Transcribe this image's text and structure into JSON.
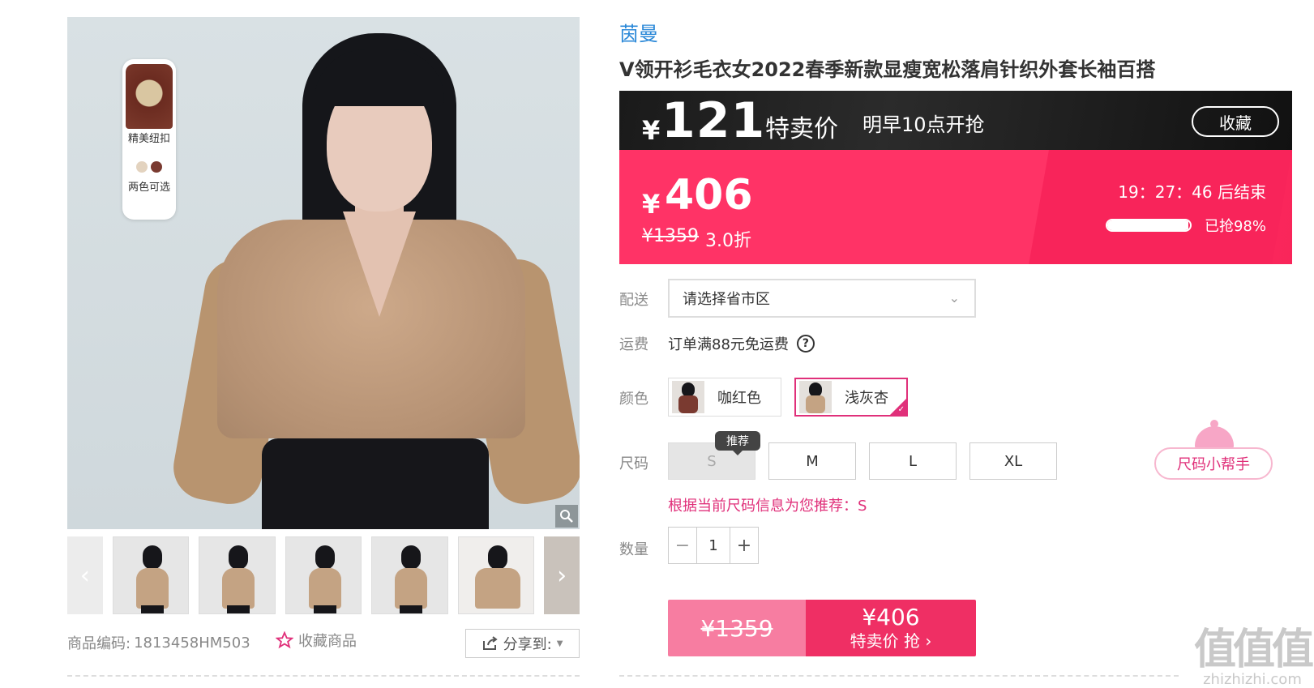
{
  "gallery": {
    "feature_badge": {
      "label_top": "精美纽扣",
      "label_bottom": "两色可选",
      "dot_colors": [
        "#e3d3bf",
        "#7a3a30"
      ]
    },
    "zoom_icon": "magnifier-icon",
    "thumb_count": 6
  },
  "meta": {
    "product_code_label": "商品编码:",
    "product_code": "1813458HM503",
    "favorite_label": "收藏商品",
    "share_label": "分享到:"
  },
  "product": {
    "brand": "茵曼",
    "title": "V领开衫毛衣女2022春季新款显瘦宽松落肩针织外套长袖百搭"
  },
  "flash_sale": {
    "currency": "¥",
    "price": "121",
    "label": "特卖价",
    "start_text": "明早10点开抢",
    "collect_label": "收藏"
  },
  "price_panel": {
    "currency": "¥",
    "current_price": "406",
    "original_price": "¥1359",
    "discount": "3.0折",
    "countdown": "19：27：46  后结束",
    "sold_label": "已抢98%",
    "sold_fraction": 0.98
  },
  "delivery": {
    "label": "配送",
    "placeholder": "请选择省市区"
  },
  "shipping": {
    "label": "运费",
    "text": "订单满88元免运费"
  },
  "color": {
    "label": "颜色",
    "options": [
      {
        "name": "咖红色",
        "swatch": "#7a3a30",
        "selected": false
      },
      {
        "name": "浅灰杏",
        "swatch": "#c4a383",
        "selected": true
      }
    ]
  },
  "size": {
    "label": "尺码",
    "options": [
      "S",
      "M",
      "L",
      "XL"
    ],
    "recommend_tag": "推荐",
    "helper_label": "尺码小帮手",
    "hint": "根据当前尺码信息为您推荐：S"
  },
  "quantity": {
    "label": "数量",
    "value": "1",
    "minus": "−",
    "plus": "+"
  },
  "buy_button": {
    "original_price": "¥1359",
    "price": "¥406",
    "action": "特卖价 抢 ›"
  },
  "watermark": {
    "logo": "值值值",
    "url": "zhizhizhi.com"
  }
}
